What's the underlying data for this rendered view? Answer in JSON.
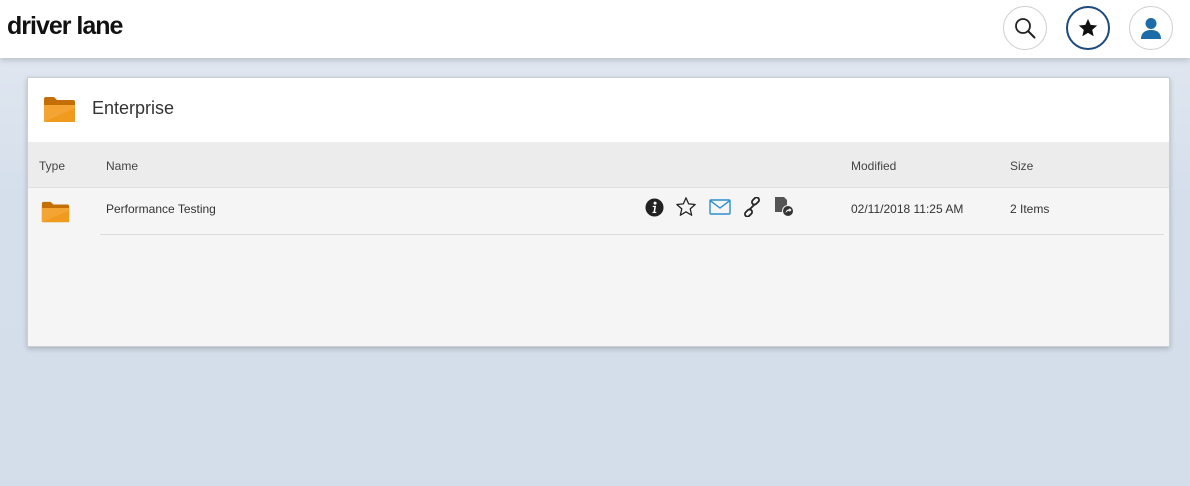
{
  "app": {
    "logo_text": "driver lane"
  },
  "header_buttons": {
    "search": "search-icon",
    "favorites": "star-icon",
    "profile": "user-icon"
  },
  "panel": {
    "title": "Enterprise",
    "icon": "folder-icon"
  },
  "table": {
    "columns": {
      "type": "Type",
      "name": "Name",
      "modified": "Modified",
      "size": "Size"
    },
    "rows": [
      {
        "type_icon": "folder-icon",
        "name": "Performance Testing",
        "modified": "02/11/2018 11:25 AM",
        "size": "2 Items",
        "actions": [
          "info-icon",
          "star-outline-icon",
          "email-icon",
          "link-icon",
          "document-share-icon"
        ]
      }
    ]
  },
  "colors": {
    "folder": "#e48a12",
    "accent_blue": "#1f4a7c",
    "user_blue": "#1b6ca8",
    "email_blue": "#2a8fd0"
  }
}
